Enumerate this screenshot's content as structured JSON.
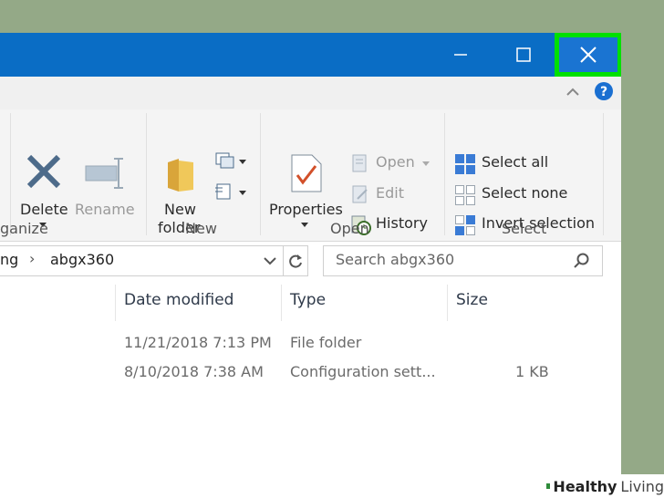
{
  "window": {
    "minimize_glyph": "—",
    "maximize_glyph": "☐",
    "close_glyph": "✕"
  },
  "ribbon": {
    "organize": {
      "label": "ganize",
      "delete_label": "Delete",
      "rename_label": "Rename"
    },
    "new": {
      "label": "New",
      "new_folder_line1": "New",
      "new_folder_line2": "folder"
    },
    "open": {
      "label": "Open",
      "properties_label": "Properties",
      "open_label": "Open",
      "edit_label": "Edit",
      "history_label": "History"
    },
    "select": {
      "label": "Select",
      "select_all_label": "Select all",
      "select_none_label": "Select none",
      "invert_label": "Invert selection"
    }
  },
  "address": {
    "crumb_prev": "ng",
    "separator": "›",
    "crumb_current": "abgx360"
  },
  "search": {
    "placeholder": "Search abgx360"
  },
  "columns": {
    "date_modified": "Date modified",
    "type": "Type",
    "size": "Size"
  },
  "rows": [
    {
      "date": "11/21/2018 7:13 PM",
      "type": "File folder",
      "size": ""
    },
    {
      "date": "8/10/2018 7:38 AM",
      "type": "Configuration sett...",
      "size": "1 KB"
    }
  ],
  "watermark": {
    "brand_bold": "Healthy",
    "brand_regular": "Living"
  },
  "colors": {
    "titlebar": "#0a6dc5",
    "highlight": "#00e000",
    "background": "#94a987"
  }
}
